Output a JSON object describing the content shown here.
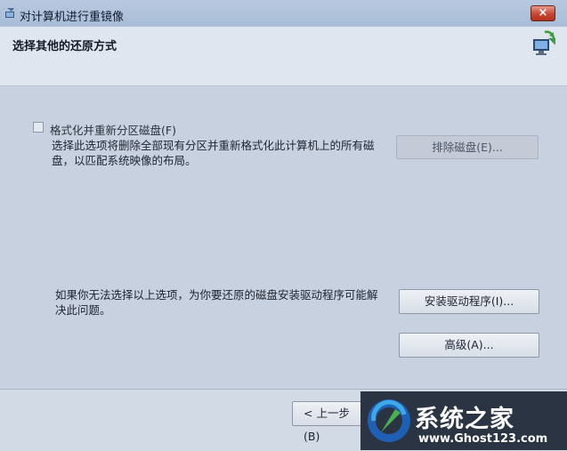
{
  "window": {
    "title": "对计算机进行重镜像",
    "close_label": "×"
  },
  "header": {
    "title": "选择其他的还原方式"
  },
  "format_option": {
    "checkbox_label": "格式化并重新分区磁盘(F)",
    "checked": false,
    "description": "选择此选项将删除全部现有分区并重新格式化此计算机上的所有磁盘，以匹配系统映像的布局。",
    "exclude_disks_button": "排除磁盘(E)..."
  },
  "driver_section": {
    "description": "如果你无法选择以上选项，为你要还原的磁盘安装驱动程序可能解决此问题。",
    "install_driver_button": "安装驱动程序(I)...",
    "advanced_button": "高级(A)..."
  },
  "footer": {
    "back_button": "< 上一步(B)"
  },
  "watermark": {
    "brand": "系统之家",
    "url": "www.Ghost123.com"
  },
  "icons": [
    "app-icon",
    "computer-restore-icon",
    "close-icon",
    "checkbox-icon",
    "watermark-logo"
  ]
}
